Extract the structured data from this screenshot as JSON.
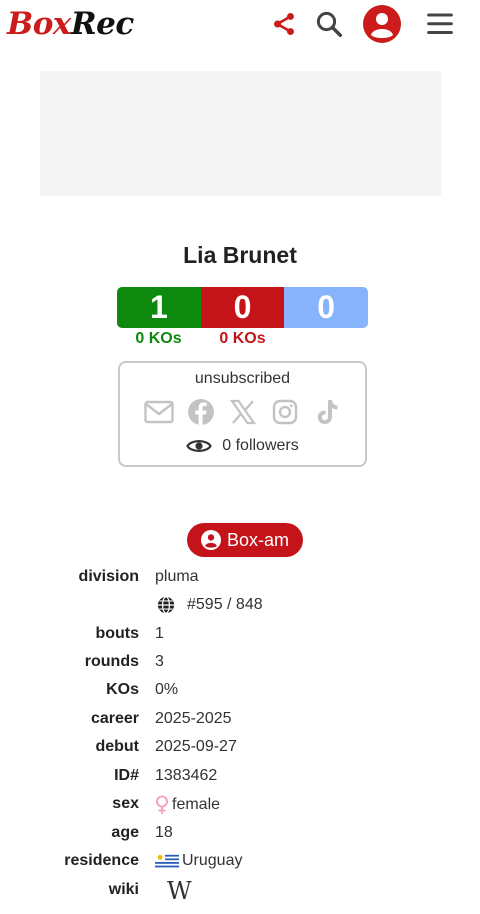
{
  "header": {
    "logo_box": "Box",
    "logo_rec": "Rec",
    "icons": [
      "share-icon",
      "search-icon",
      "user-account-icon",
      "menu-icon"
    ],
    "accent_color": "#cc1b1b"
  },
  "boxer": {
    "name": "Lia Brunet"
  },
  "record": {
    "wins": "1",
    "losses": "0",
    "draws": "0",
    "win_kos": "0 KOs",
    "loss_kos": "0 KOs",
    "colors": {
      "win": "#0d8a0d",
      "loss": "#c4141a",
      "draw": "#86b3fb"
    }
  },
  "subscription": {
    "status": "unsubscribed",
    "social_icons": [
      "email-icon",
      "facebook-icon",
      "x-icon",
      "instagram-icon",
      "tiktok-icon"
    ],
    "followers": "0 followers"
  },
  "badge": {
    "label": "Box-am"
  },
  "details": {
    "division_label": "division",
    "division_value": "pluma",
    "rank_value": "#595 / 848",
    "bouts_label": "bouts",
    "bouts_value": "1",
    "rounds_label": "rounds",
    "rounds_value": "3",
    "kos_label": "KOs",
    "kos_value": "0%",
    "career_label": "career",
    "career_value": "2025-2025",
    "debut_label": "debut",
    "debut_value": "2025-09-27",
    "id_label": "ID#",
    "id_value": "1383462",
    "sex_label": "sex",
    "sex_value": "female",
    "age_label": "age",
    "age_value": "18",
    "residence_label": "residence",
    "residence_value": "Uruguay",
    "wiki_label": "wiki"
  }
}
